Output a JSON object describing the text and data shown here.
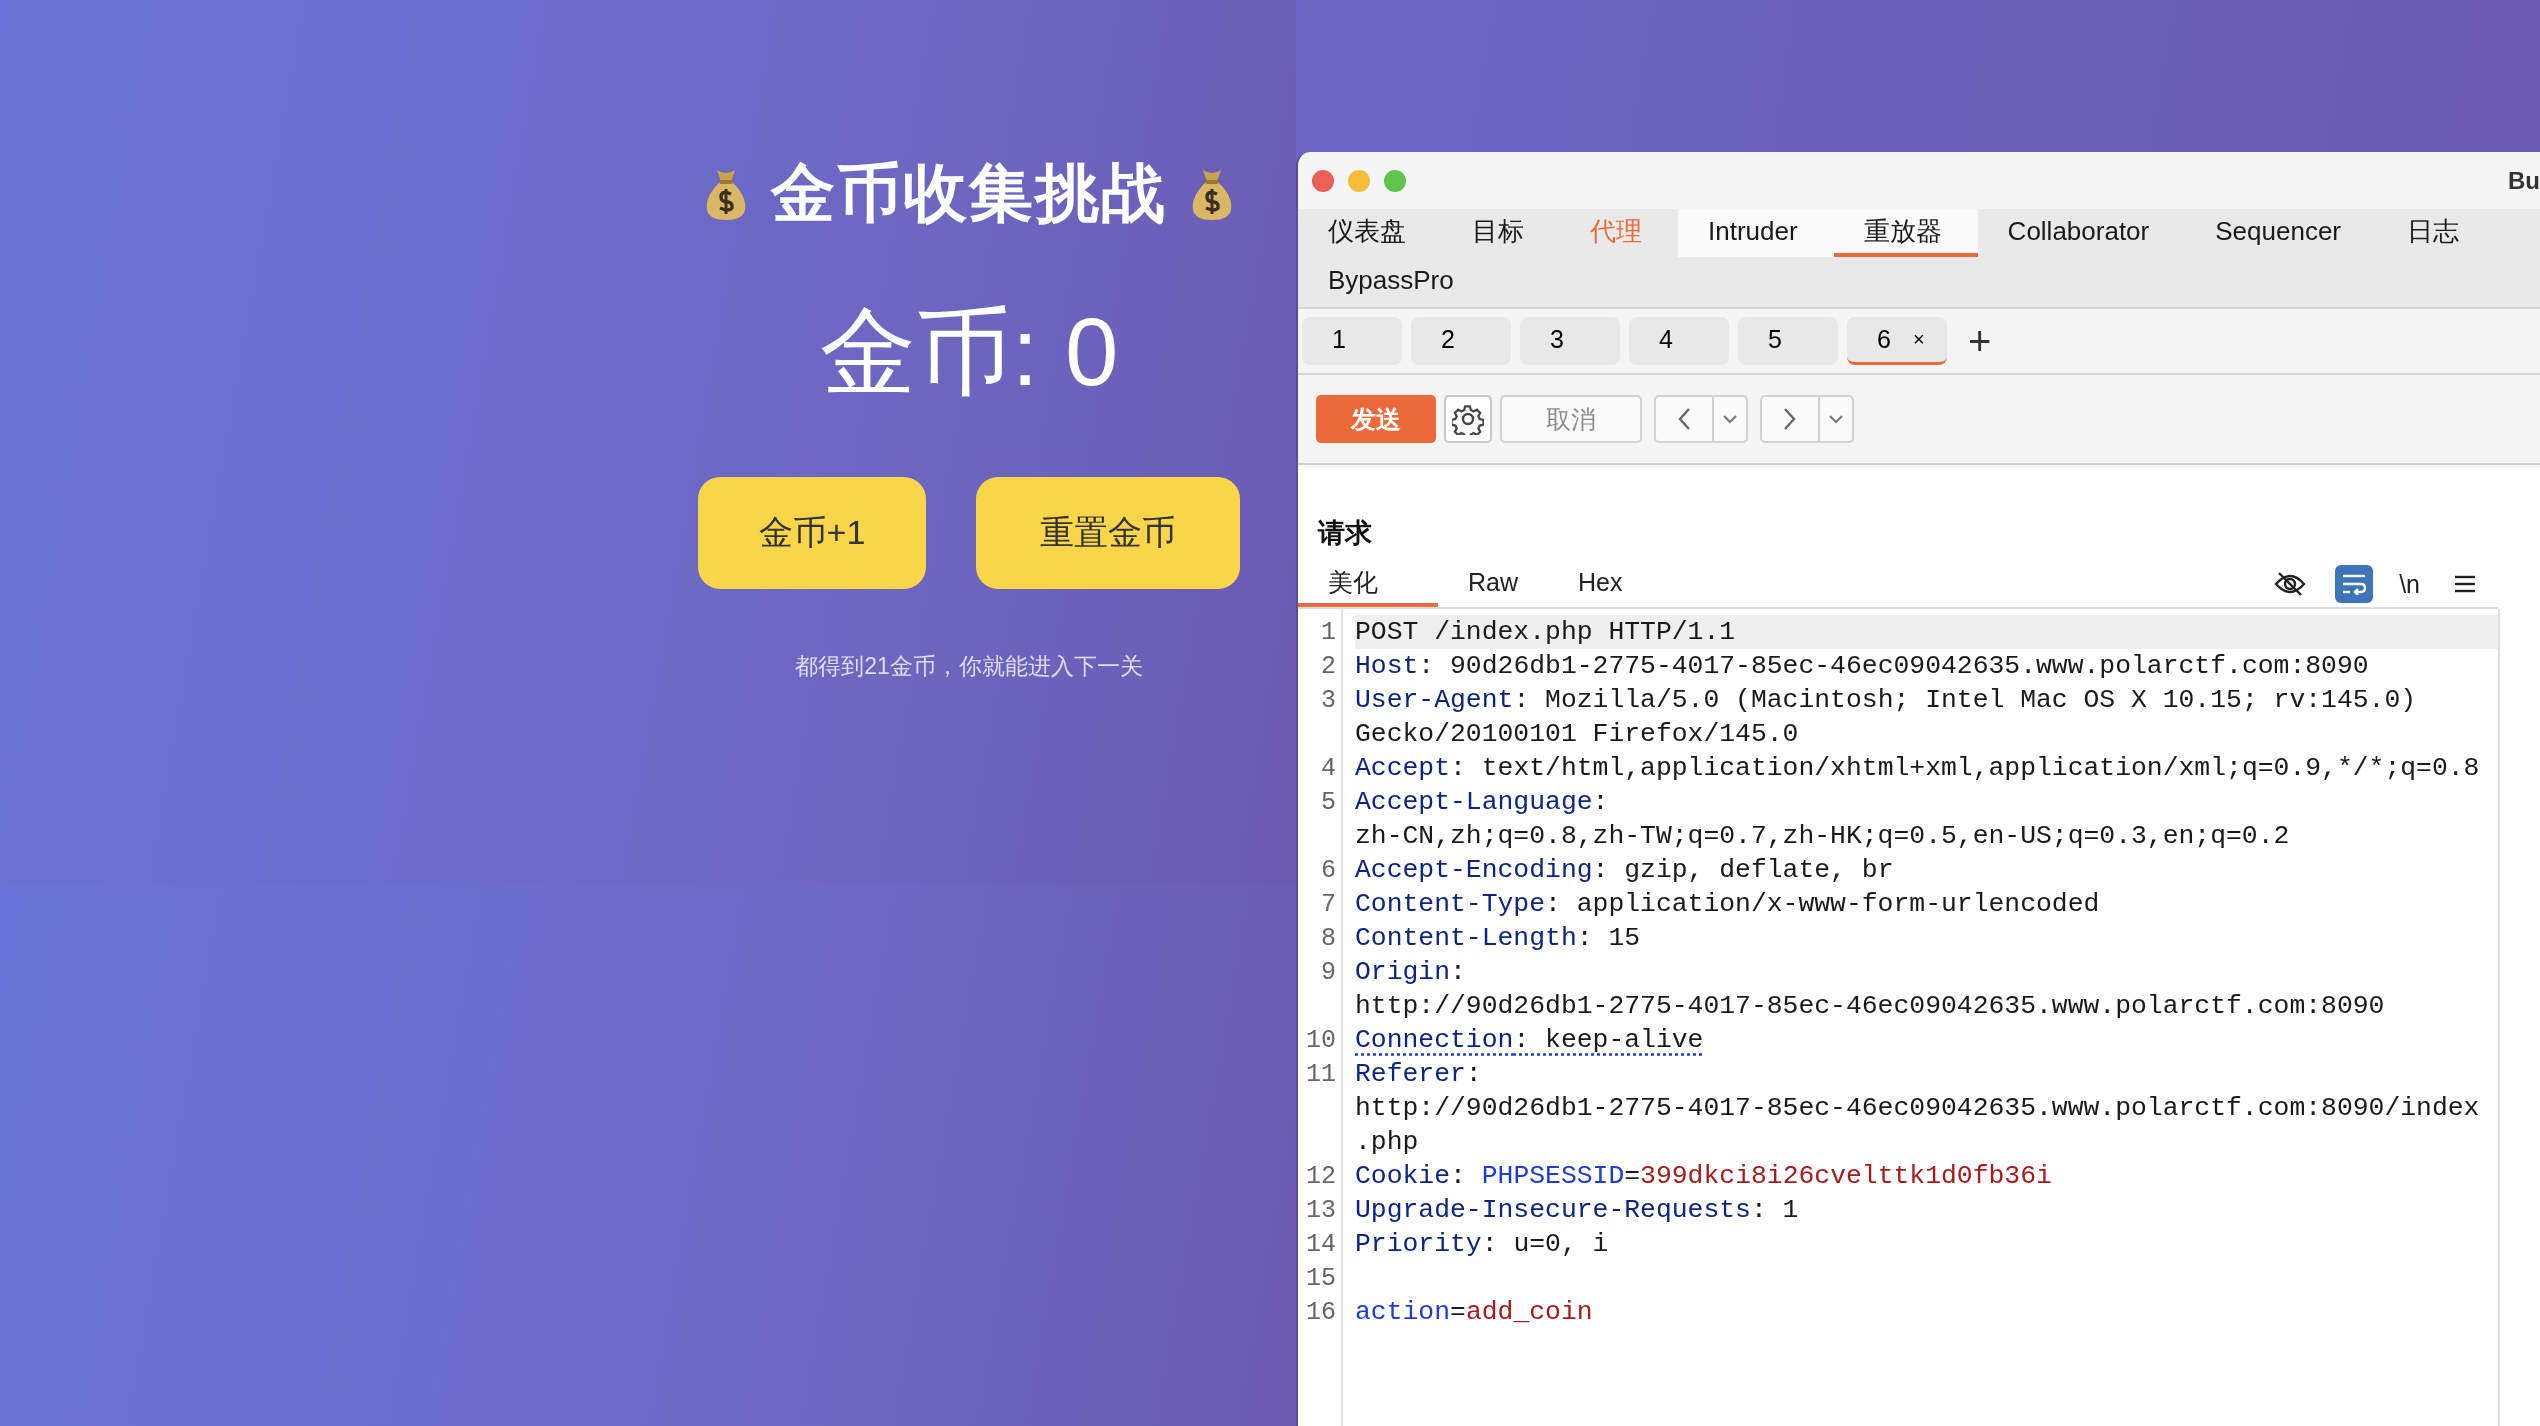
{
  "page": {
    "title": "金币收集挑战",
    "coins": "金币: 0",
    "buttons": [
      "金币+1",
      "重置金币"
    ],
    "hint": "都得到21金币，你就能进入下一关"
  },
  "window": {
    "title": "Bu"
  },
  "tabs": [
    {
      "label": "仪表盘",
      "selected": false,
      "highlighted": false,
      "hovered": false
    },
    {
      "label": "目标",
      "selected": false,
      "highlighted": false,
      "hovered": false
    },
    {
      "label": "代理",
      "selected": false,
      "highlighted": true,
      "hovered": false
    },
    {
      "label": "Intruder",
      "selected": false,
      "highlighted": false,
      "hovered": true
    },
    {
      "label": "重放器",
      "selected": true,
      "highlighted": false,
      "hovered": false
    },
    {
      "label": "Collaborator",
      "selected": false,
      "highlighted": false,
      "hovered": false
    },
    {
      "label": "Sequencer",
      "selected": false,
      "highlighted": false,
      "hovered": false
    },
    {
      "label": "日志",
      "selected": false,
      "highlighted": false,
      "hovered": false
    },
    {
      "label": "BypassPro",
      "selected": false,
      "highlighted": false,
      "hovered": false
    }
  ],
  "request_tabs": [
    {
      "label": "1",
      "selected": false
    },
    {
      "label": "2",
      "selected": false
    },
    {
      "label": "3",
      "selected": false
    },
    {
      "label": "4",
      "selected": false
    },
    {
      "label": "5",
      "selected": false
    },
    {
      "label": "6",
      "selected": true,
      "close": "×"
    }
  ],
  "add_tab": "+",
  "toolbar": {
    "send": "发送",
    "cancel": "取消",
    "cancel_disabled": true
  },
  "request": {
    "title": "请求",
    "view_tabs": [
      {
        "label": "美化",
        "selected": true
      },
      {
        "label": "Raw",
        "selected": false
      },
      {
        "label": "Hex",
        "selected": false
      }
    ],
    "wrap_enabled": true,
    "newline_toggle": "\\n",
    "lines": [
      {
        "number": "1",
        "highlighted": true,
        "underlined": false,
        "segments": [
          {
            "kind": "text",
            "text": "POST /index.php HTTP/1.1"
          }
        ]
      },
      {
        "number": "2",
        "highlighted": false,
        "underlined": false,
        "segments": [
          {
            "kind": "key",
            "text": "Host"
          },
          {
            "kind": "text",
            "text": ": 90d26db1-2775-4017-85ec-46ec09042635.www.polarctf.com:8090"
          }
        ]
      },
      {
        "number": "3",
        "highlighted": false,
        "underlined": false,
        "segments": [
          {
            "kind": "key",
            "text": "User-Agent"
          },
          {
            "kind": "text",
            "text": ": Mozilla/5.0 (Macintosh; Intel Mac OS X 10.15; rv:145.0)"
          }
        ]
      },
      {
        "highlighted": false,
        "underlined": false,
        "segments": [
          {
            "kind": "text",
            "text": "Gecko/20100101 Firefox/145.0"
          }
        ]
      },
      {
        "number": "4",
        "highlighted": false,
        "underlined": false,
        "segments": [
          {
            "kind": "key",
            "text": "Accept"
          },
          {
            "kind": "text",
            "text": ": text/html,application/xhtml+xml,application/xml;q=0.9,*/*;q=0.8"
          }
        ]
      },
      {
        "number": "5",
        "highlighted": false,
        "underlined": false,
        "segments": [
          {
            "kind": "key",
            "text": "Accept-Language"
          },
          {
            "kind": "text",
            "text": ":"
          }
        ]
      },
      {
        "highlighted": false,
        "underlined": false,
        "segments": [
          {
            "kind": "text",
            "text": "zh-CN,zh;q=0.8,zh-TW;q=0.7,zh-HK;q=0.5,en-US;q=0.3,en;q=0.2"
          }
        ]
      },
      {
        "number": "6",
        "highlighted": false,
        "underlined": false,
        "segments": [
          {
            "kind": "key",
            "text": "Accept-Encoding"
          },
          {
            "kind": "text",
            "text": ": gzip, deflate, br"
          }
        ]
      },
      {
        "number": "7",
        "highlighted": false,
        "underlined": false,
        "segments": [
          {
            "kind": "key",
            "text": "Content-Type"
          },
          {
            "kind": "text",
            "text": ": application/x-www-form-urlencoded"
          }
        ]
      },
      {
        "number": "8",
        "highlighted": false,
        "underlined": false,
        "segments": [
          {
            "kind": "key",
            "text": "Content-Length"
          },
          {
            "kind": "text",
            "text": ": 15"
          }
        ]
      },
      {
        "number": "9",
        "highlighted": false,
        "underlined": false,
        "segments": [
          {
            "kind": "key",
            "text": "Origin"
          },
          {
            "kind": "text",
            "text": ":"
          }
        ]
      },
      {
        "highlighted": false,
        "underlined": false,
        "segments": [
          {
            "kind": "text",
            "text": "http://90d26db1-2775-4017-85ec-46ec09042635.www.polarctf.com:8090"
          }
        ]
      },
      {
        "number": "10",
        "highlighted": false,
        "underlined": true,
        "segments": [
          {
            "kind": "key",
            "text": "Connection"
          },
          {
            "kind": "text",
            "text": ": keep-alive"
          }
        ]
      },
      {
        "number": "11",
        "highlighted": false,
        "underlined": false,
        "segments": [
          {
            "kind": "key",
            "text": "Referer"
          },
          {
            "kind": "text",
            "text": ":"
          }
        ]
      },
      {
        "highlighted": false,
        "underlined": false,
        "segments": [
          {
            "kind": "text",
            "text": "http://90d26db1-2775-4017-85ec-46ec09042635.www.polarctf.com:8090/index"
          }
        ]
      },
      {
        "highlighted": false,
        "underlined": false,
        "segments": [
          {
            "kind": "text",
            "text": ".php"
          }
        ]
      },
      {
        "number": "12",
        "highlighted": false,
        "underlined": false,
        "segments": [
          {
            "kind": "key",
            "text": "Cookie"
          },
          {
            "kind": "text",
            "text": ": "
          },
          {
            "kind": "param",
            "text": "PHPSESSID"
          },
          {
            "kind": "text",
            "text": "="
          },
          {
            "kind": "value",
            "text": "399dkci8i26cvelttk1d0fb36i"
          }
        ]
      },
      {
        "number": "13",
        "highlighted": false,
        "underlined": false,
        "segments": [
          {
            "kind": "key",
            "text": "Upgrade-Insecure-Requests"
          },
          {
            "kind": "text",
            "text": ": 1"
          }
        ]
      },
      {
        "number": "14",
        "highlighted": false,
        "underlined": false,
        "segments": [
          {
            "kind": "key",
            "text": "Priority"
          },
          {
            "kind": "text",
            "text": ": u=0, i"
          }
        ]
      },
      {
        "number": "15"
      },
      {
        "number": "16",
        "highlighted": false,
        "underlined": false,
        "segments": [
          {
            "kind": "param",
            "text": "action"
          },
          {
            "kind": "text",
            "text": "="
          },
          {
            "kind": "value",
            "text": "add_coin"
          }
        ]
      }
    ]
  }
}
